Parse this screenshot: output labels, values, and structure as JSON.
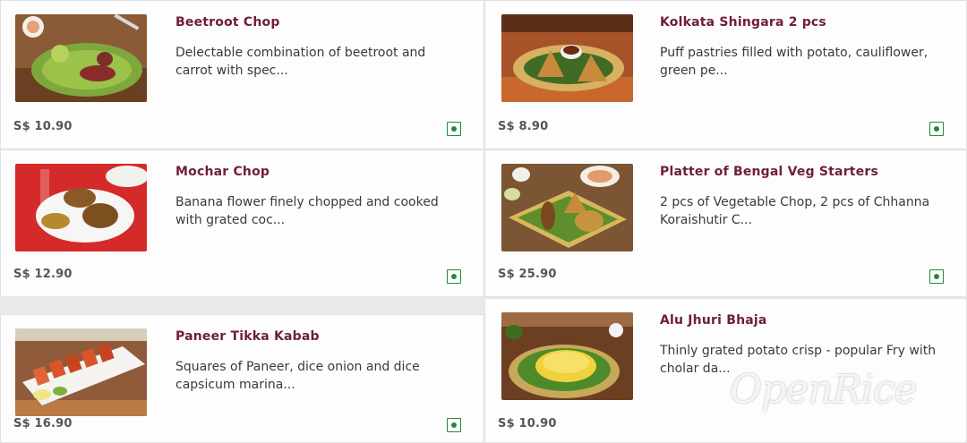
{
  "menu": {
    "items": [
      {
        "title": "Beetroot Chop",
        "description": "Delectable combination of beetroot and carrot with spec...",
        "price": "S$ 10.90",
        "diet": "veg-icon"
      },
      {
        "title": "Kolkata Shingara 2 pcs",
        "description": "Puff pastries filled with potato, cauliflower, green pe...",
        "price": "S$ 8.90",
        "diet": "veg-icon"
      },
      {
        "title": "Mochar Chop",
        "description": "Banana flower finely chopped and cooked with grated coc...",
        "price": "S$ 12.90",
        "diet": "veg-icon"
      },
      {
        "title": "Platter of Bengal Veg Starters",
        "description": "2 pcs of Vegetable Chop, 2 pcs of Chhanna Koraishutir C...",
        "price": "S$ 25.90",
        "diet": "veg-icon"
      },
      {
        "title": "Paneer Tikka Kabab",
        "description": "Squares of Paneer, dice onion and dice capsicum marina...",
        "price": "S$ 16.90",
        "diet": "veg-icon"
      },
      {
        "title": "Alu Jhuri Bhaja",
        "description": "Thinly grated potato crisp - popular Fry with cholar da...",
        "price": "S$ 10.90",
        "diet": "veg-icon"
      }
    ]
  },
  "watermark": "OpenRice",
  "colors": {
    "title": "#6e1e3b",
    "veg": "#1e8a3a",
    "text": "#3a3a3a"
  }
}
